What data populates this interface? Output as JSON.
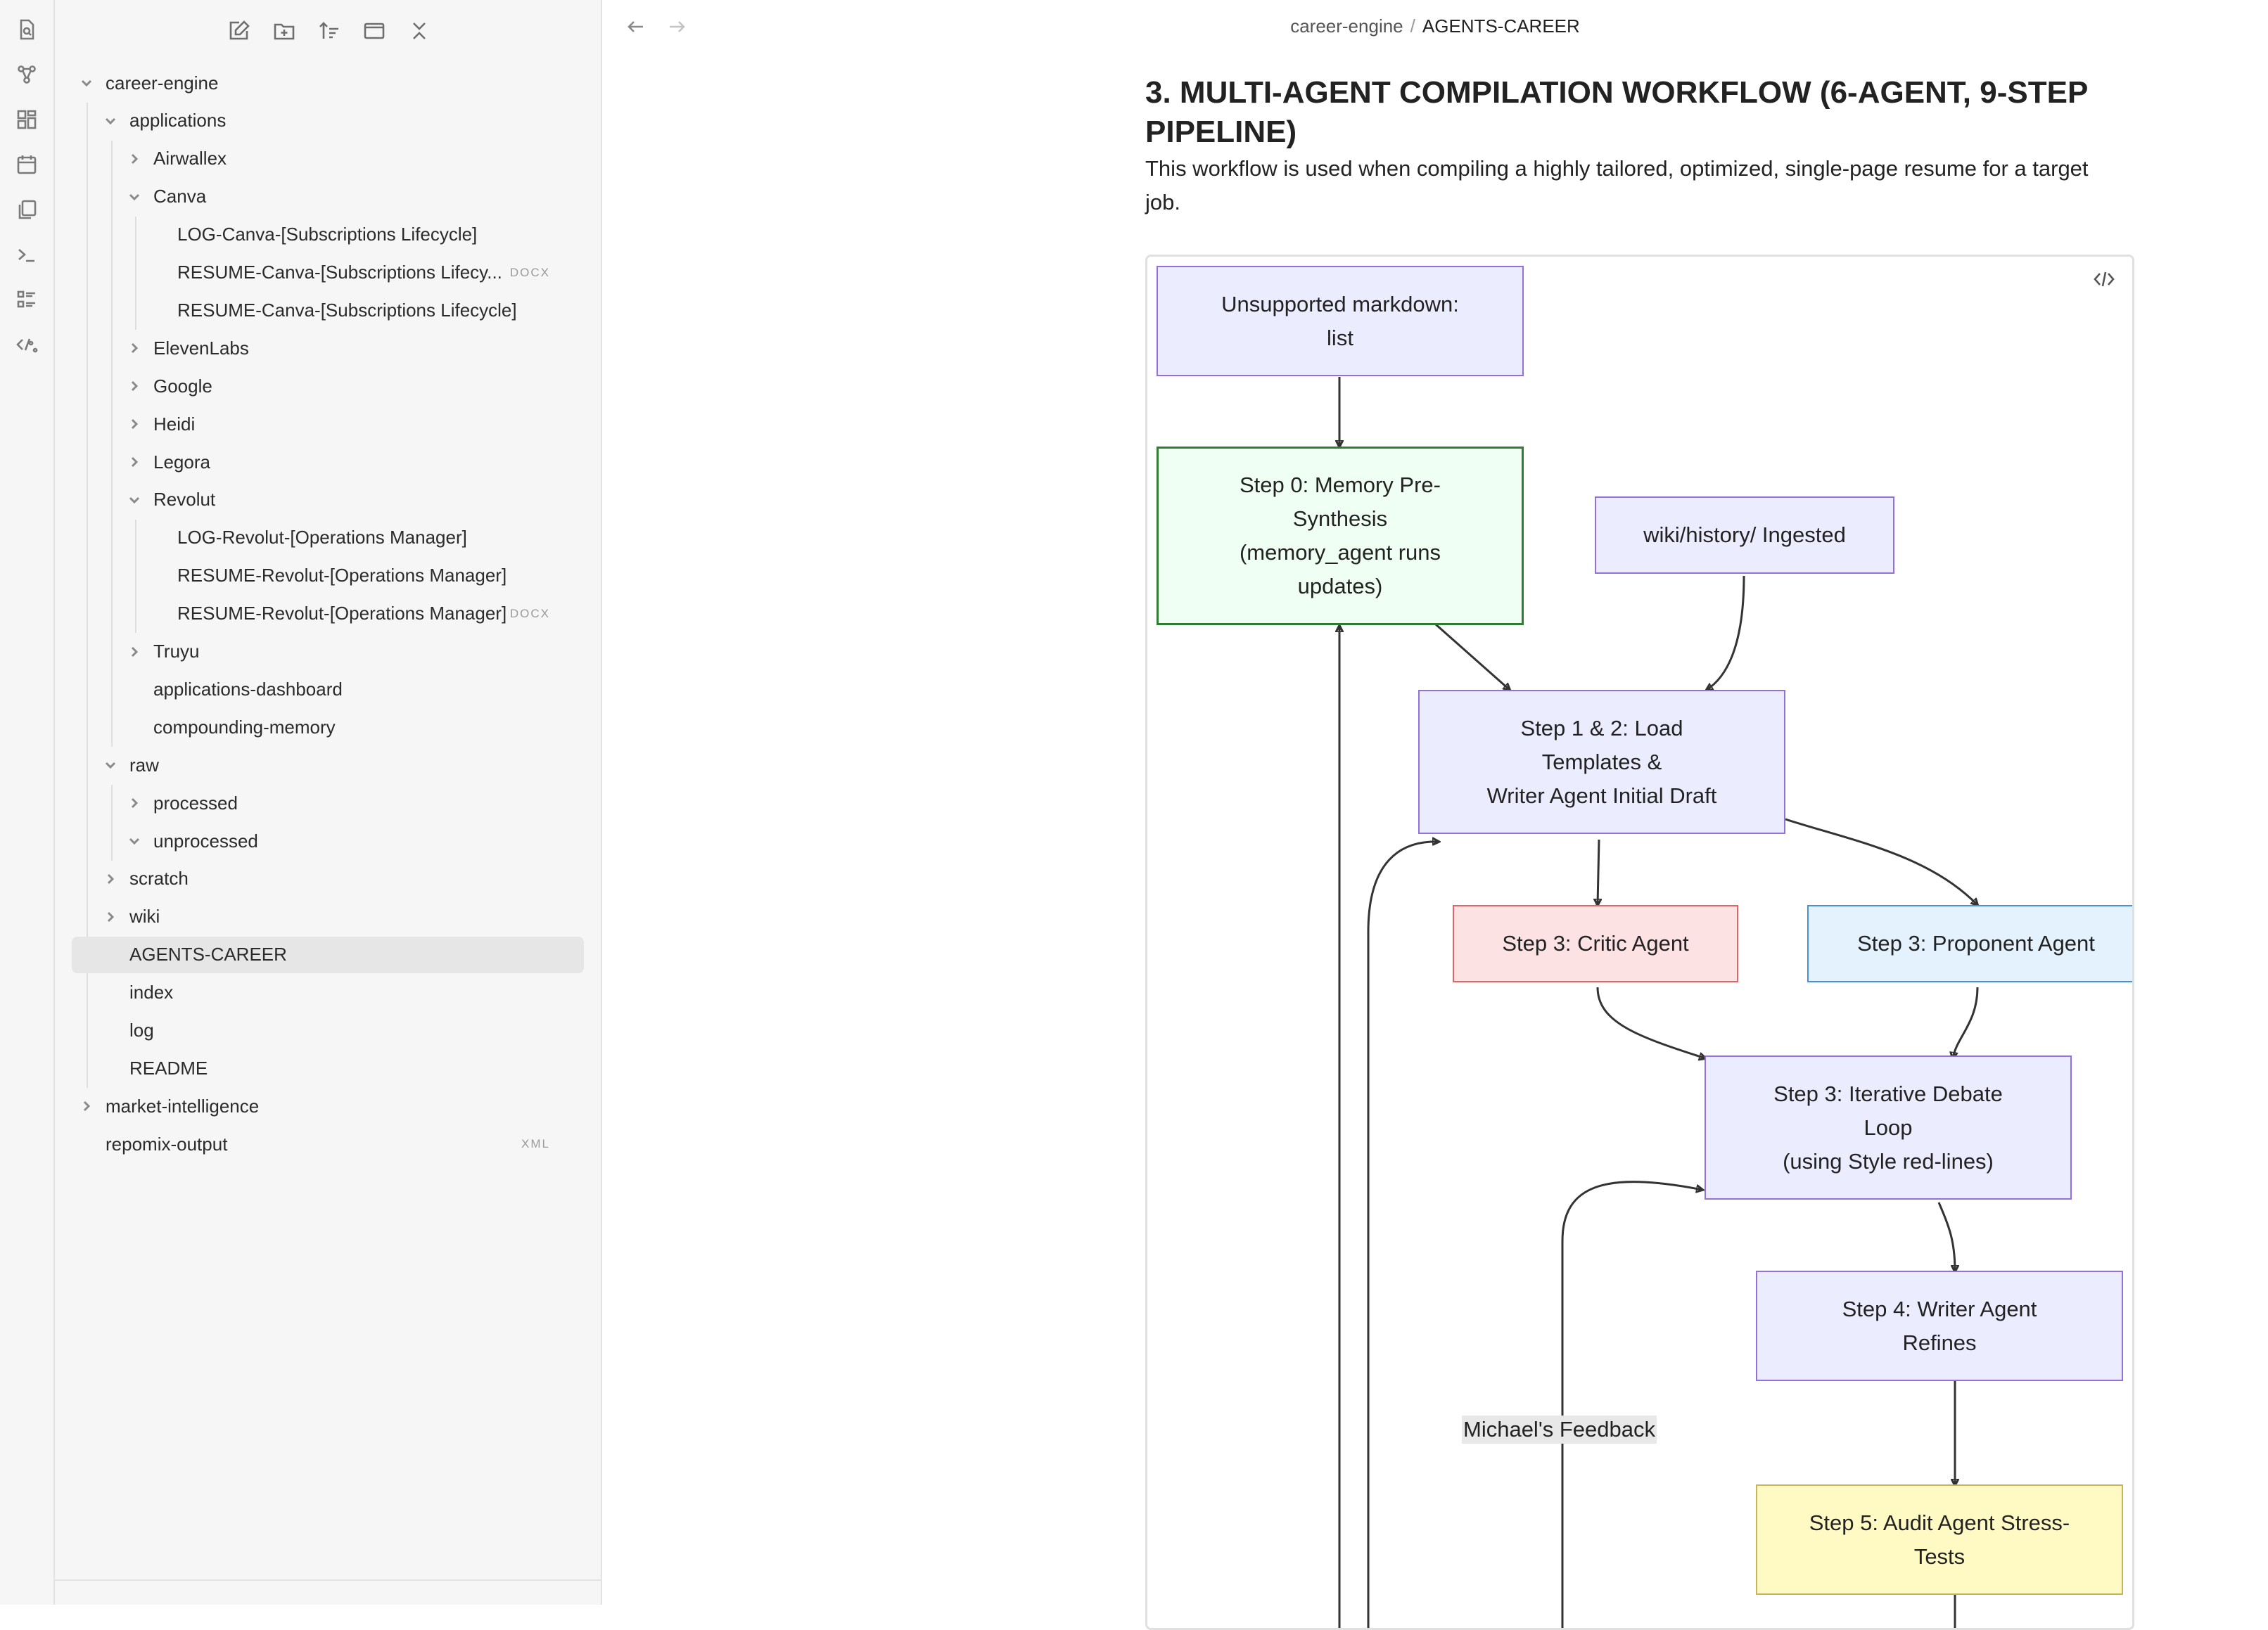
{
  "ribbon": {
    "icons": [
      "quick-switcher-icon",
      "graph-view-icon",
      "canvas-icon",
      "daily-note-icon",
      "templates-icon",
      "command-palette-icon",
      "outline-icon",
      "templater-icon"
    ]
  },
  "sidebar": {
    "toolbar": [
      "new-note-icon",
      "new-folder-icon",
      "sort-icon",
      "layout-icon",
      "collapse-all-icon"
    ],
    "tree": [
      {
        "label": "career-engine",
        "ext": "",
        "expanded": true
      },
      {
        "label": "applications",
        "ext": "",
        "expanded": true
      },
      {
        "label": "Airwallex",
        "ext": "",
        "expanded": false
      },
      {
        "label": "Canva",
        "ext": "",
        "expanded": true
      },
      {
        "label": "LOG-Canva-[Subscriptions Lifecycle]",
        "ext": ""
      },
      {
        "label": "RESUME-Canva-[Subscriptions Lifecy...",
        "ext": "DOCX"
      },
      {
        "label": "RESUME-Canva-[Subscriptions Lifecycle]",
        "ext": ""
      },
      {
        "label": "ElevenLabs",
        "ext": "",
        "expanded": false
      },
      {
        "label": "Google",
        "ext": "",
        "expanded": false
      },
      {
        "label": "Heidi",
        "ext": "",
        "expanded": false
      },
      {
        "label": "Legora",
        "ext": "",
        "expanded": false
      },
      {
        "label": "Revolut",
        "ext": "",
        "expanded": true
      },
      {
        "label": "LOG-Revolut-[Operations Manager]",
        "ext": ""
      },
      {
        "label": "RESUME-Revolut-[Operations Manager]",
        "ext": ""
      },
      {
        "label": "RESUME-Revolut-[Operations Manager]",
        "ext": "DOCX"
      },
      {
        "label": "Truyu",
        "ext": "",
        "expanded": false
      },
      {
        "label": "applications-dashboard",
        "ext": ""
      },
      {
        "label": "compounding-memory",
        "ext": ""
      },
      {
        "label": "raw",
        "ext": "",
        "expanded": true
      },
      {
        "label": "processed",
        "ext": "",
        "expanded": false
      },
      {
        "label": "unprocessed",
        "ext": "",
        "expanded": true
      },
      {
        "label": "scratch",
        "ext": "",
        "expanded": false
      },
      {
        "label": "wiki",
        "ext": "",
        "expanded": false
      },
      {
        "label": "AGENTS-CAREER",
        "ext": "",
        "selected": true
      },
      {
        "label": "index",
        "ext": ""
      },
      {
        "label": "log",
        "ext": ""
      },
      {
        "label": "README",
        "ext": ""
      },
      {
        "label": "market-intelligence",
        "ext": "",
        "expanded": false
      },
      {
        "label": "repomix-output",
        "ext": "XML"
      }
    ]
  },
  "main": {
    "breadcrumb": {
      "parent": "career-engine",
      "separator": "/",
      "current": "AGENTS-CAREER"
    },
    "heading": "3. MULTI-AGENT COMPILATION WORKFLOW (6-AGENT, 9-STEP PIPELINE)",
    "description": "This workflow is used when compiling a highly tailored, optimized, single-page resume for a target job.",
    "diagram": {
      "nodes": [
        {
          "id": "unsupported",
          "text": "Unsupported markdown:\nlist",
          "style": "purple"
        },
        {
          "id": "step0",
          "text": "Step 0: Memory Pre-\nSynthesis\n(memory_agent runs\nupdates)",
          "style": "green"
        },
        {
          "id": "wiki",
          "text": "wiki/history/ Ingested",
          "style": "purple"
        },
        {
          "id": "step12",
          "text": "Step 1 & 2: Load\nTemplates &\nWriter Agent Initial Draft",
          "style": "purple"
        },
        {
          "id": "critic",
          "text": "Step 3: Critic Agent",
          "style": "red"
        },
        {
          "id": "proponent",
          "text": "Step 3: Proponent Agent",
          "style": "blue"
        },
        {
          "id": "debate",
          "text": "Step 3: Iterative Debate\nLoop\n(using Style red-lines)",
          "style": "purple"
        },
        {
          "id": "step4",
          "text": "Step 4: Writer Agent\nRefines",
          "style": "purple"
        },
        {
          "id": "step5",
          "text": "Step 5: Audit Agent Stress-\nTests",
          "style": "yellow"
        }
      ],
      "edge_labels": [
        "Michael's Feedback"
      ],
      "colors": {
        "purple_fill": "#ececff",
        "purple_stroke": "#9370db",
        "green_fill": "#f0fff4",
        "green_stroke": "#2e7d32",
        "red_fill": "#fde2e4",
        "blue_fill": "#e3f2fd",
        "yellow_fill": "#fff9c4"
      }
    }
  }
}
